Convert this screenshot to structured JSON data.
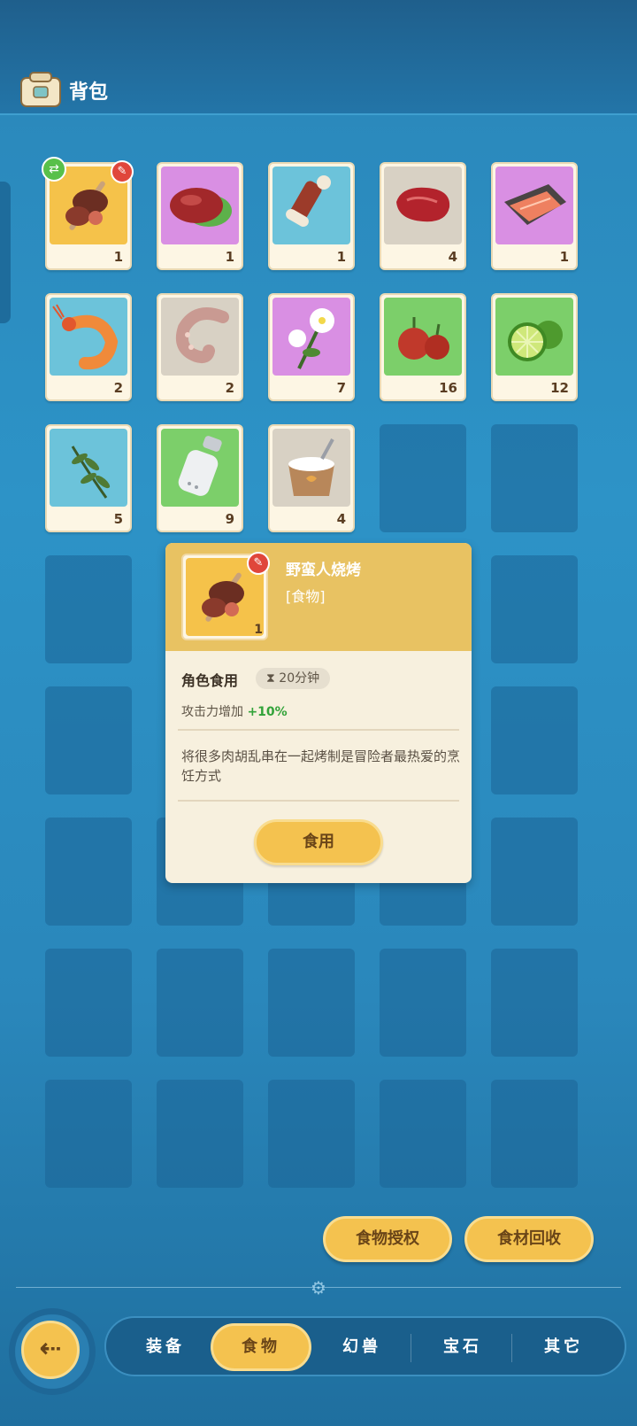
{
  "header": {
    "title": "背包",
    "icon": "backpack-icon"
  },
  "inventory": {
    "items": [
      {
        "name": "barbarian-bbq",
        "qty": "1",
        "bg": "yellow",
        "badge_edit": true,
        "badge_share": true
      },
      {
        "name": "meat-with-lettuce",
        "qty": "1",
        "bg": "purple"
      },
      {
        "name": "bone-meat",
        "qty": "1",
        "bg": "blue"
      },
      {
        "name": "raw-steak",
        "qty": "4",
        "bg": "gray"
      },
      {
        "name": "salmon-fillet",
        "qty": "1",
        "bg": "purple"
      },
      {
        "name": "shrimp",
        "qty": "2",
        "bg": "blue"
      },
      {
        "name": "octopus-tentacle",
        "qty": "2",
        "bg": "gray"
      },
      {
        "name": "white-flower",
        "qty": "7",
        "bg": "purple"
      },
      {
        "name": "red-peppers",
        "qty": "16",
        "bg": "green"
      },
      {
        "name": "lime",
        "qty": "12",
        "bg": "green"
      },
      {
        "name": "herb-sprig",
        "qty": "5",
        "bg": "blue"
      },
      {
        "name": "salt-shaker",
        "qty": "9",
        "bg": "green"
      },
      {
        "name": "rice-box",
        "qty": "4",
        "bg": "gray"
      }
    ]
  },
  "popup": {
    "name": "野蛮人烧烤",
    "type": "[食物]",
    "qty": "1",
    "use_label": "角色食用",
    "duration": "20分钟",
    "effect_label": "攻击力增加",
    "effect_value": "+10%",
    "description": "将很多肉胡乱串在一起烤制是冒险者最热爱的烹饪方式",
    "eat_button": "食用"
  },
  "actions": {
    "food_auth": "食物授权",
    "recycle": "食材回收"
  },
  "nav": {
    "back_icon": "back-arrow-icon",
    "tabs": [
      "装备",
      "食物",
      "幻兽",
      "宝石",
      "其它"
    ],
    "active_tab": "食物"
  },
  "colors": {
    "accent": "#f4c24f",
    "slot_bg": "#fdf6e4",
    "effect_green": "#33a33a"
  }
}
